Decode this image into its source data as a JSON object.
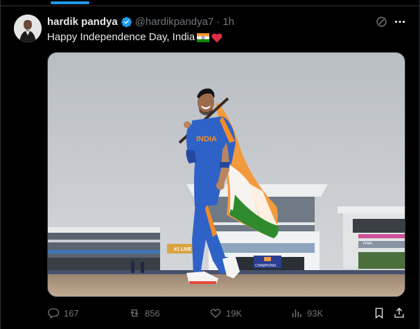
{
  "tweet": {
    "display_name": "hardik pandya",
    "handle": "@hardikpandya7",
    "separator": "·",
    "time": "1h",
    "text": "Happy Independence Day, India",
    "text_emojis": [
      "flag-india",
      "red-heart"
    ]
  },
  "media": {
    "banners": [
      "#1 LIVE",
      "CHAMPIONS",
      "FINAL"
    ]
  },
  "metrics": {
    "replies": "167",
    "reposts": "856",
    "likes": "19K",
    "views": "93K"
  },
  "colors": {
    "background": "#000000",
    "accent": "#1d9bf0",
    "text_primary": "#e7e9ea",
    "text_secondary": "#71767b",
    "divider": "#2f3336",
    "jersey_blue": "#2f62c6"
  },
  "icons": [
    "verified-badge-icon",
    "grok-icon",
    "more-icon",
    "reply-icon",
    "repost-icon",
    "like-icon",
    "views-icon",
    "bookmark-icon",
    "share-icon"
  ]
}
